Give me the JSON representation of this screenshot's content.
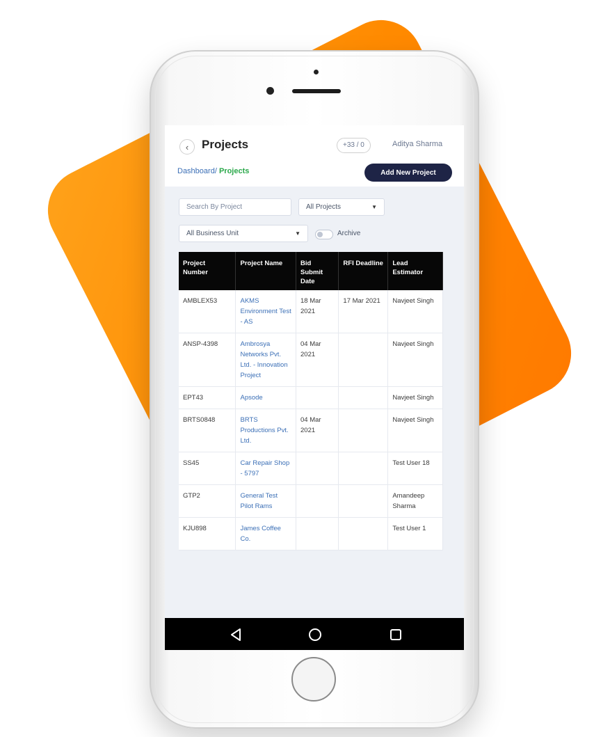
{
  "header": {
    "back_icon": "chevron-left-icon",
    "title": "Projects",
    "counter": "+33 / 0",
    "user_name": "Aditya Sharma",
    "add_button_label": "Add New Project"
  },
  "breadcrumb": {
    "root": "Dashboard",
    "separator": "/",
    "current": "Projects"
  },
  "filters": {
    "search_placeholder": "Search By Project",
    "project_filter": "All Projects",
    "business_unit_filter": "All Business Unit",
    "archive_label": "Archive"
  },
  "table": {
    "headers": [
      "Project Number",
      "Project Name",
      "Bid Submit Date",
      "RFI Deadline",
      "Lead Estimator"
    ],
    "rows": [
      {
        "number": "AMBLEX53",
        "name": "AKMS Environment Test - AS",
        "bid": "18 Mar 2021",
        "rfi": "17 Mar 2021",
        "lead": "Navjeet Singh"
      },
      {
        "number": "ANSP-4398",
        "name": "Ambrosya Networks Pvt. Ltd. - Innovation Project",
        "bid": "04 Mar 2021",
        "rfi": "",
        "lead": "Navjeet Singh"
      },
      {
        "number": "EPT43",
        "name": "Apsode",
        "bid": "",
        "rfi": "",
        "lead": "Navjeet Singh"
      },
      {
        "number": "BRTS0848",
        "name": "BRTS Productions Pvt. Ltd.",
        "bid": "04 Mar 2021",
        "rfi": "",
        "lead": "Navjeet Singh"
      },
      {
        "number": "SS45",
        "name": "Car Repair Shop - 5797",
        "bid": "",
        "rfi": "",
        "lead": "Test User 18"
      },
      {
        "number": "GTP2",
        "name": "General Test Pilot Rams",
        "bid": "",
        "rfi": "",
        "lead": "Amandeep Sharma"
      },
      {
        "number": "KJU898",
        "name": "James Coffee Co.",
        "bid": "",
        "rfi": "",
        "lead": "Test User 1"
      }
    ]
  },
  "navbar": {
    "back_icon": "triangle-back-icon",
    "home_icon": "circle-home-icon",
    "recent_icon": "square-recent-icon"
  },
  "colors": {
    "accent_orange": "#ff8a00",
    "button_navy": "#1e2446",
    "link_blue": "#3b6fb6",
    "breadcrumb_green": "#2aa84a"
  }
}
